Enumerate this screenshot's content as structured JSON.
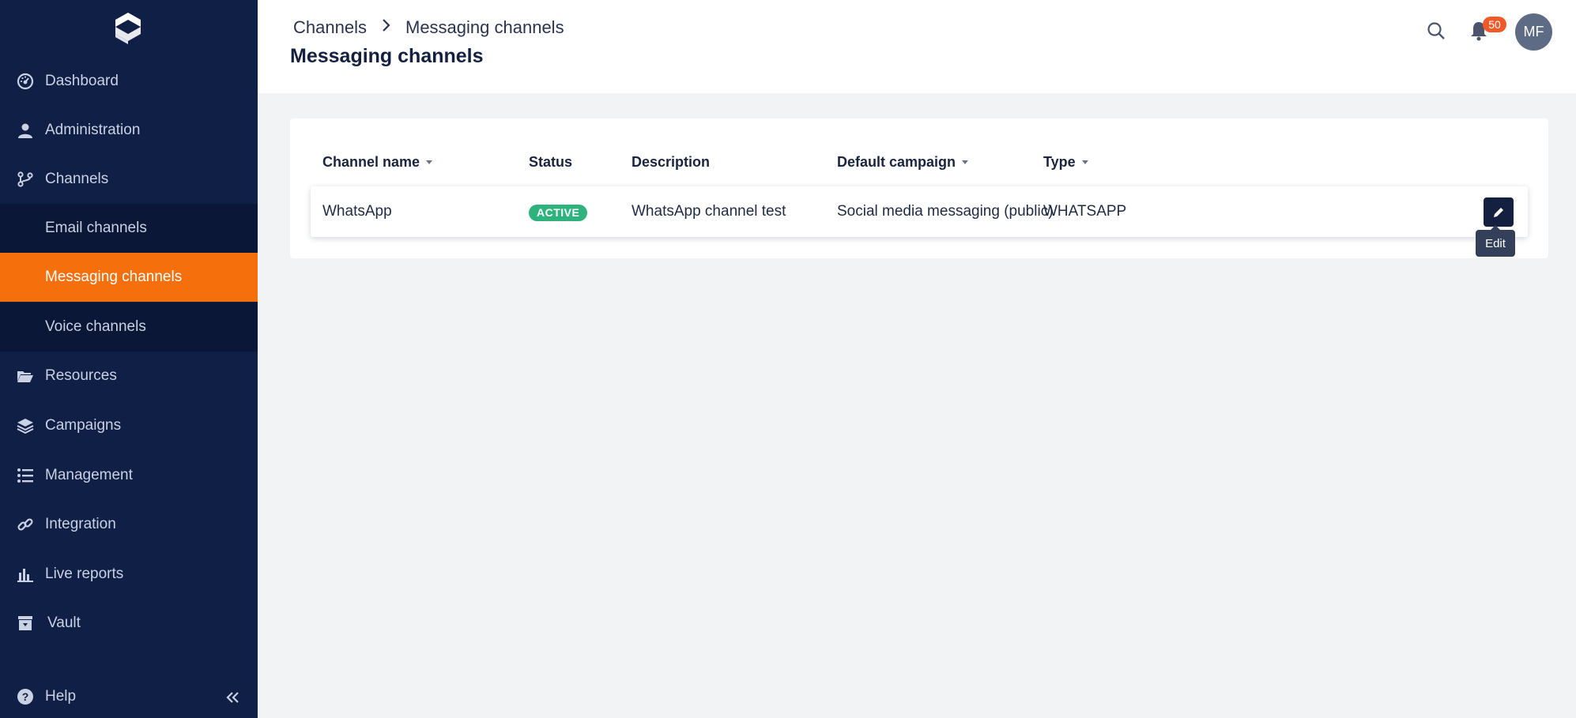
{
  "sidebar": {
    "items": [
      {
        "label": "Dashboard",
        "icon": "dashboard-gauge-icon"
      },
      {
        "label": "Administration",
        "icon": "user-icon"
      },
      {
        "label": "Channels",
        "icon": "branch-icon"
      },
      {
        "label": "Email channels"
      },
      {
        "label": "Messaging channels"
      },
      {
        "label": "Voice channels"
      },
      {
        "label": "Resources",
        "icon": "folder-open-icon"
      },
      {
        "label": "Campaigns",
        "icon": "layers-icon"
      },
      {
        "label": "Management",
        "icon": "list-icon"
      },
      {
        "label": "Integration",
        "icon": "link-icon"
      },
      {
        "label": "Live reports",
        "icon": "bar-chart-icon"
      },
      {
        "label": "Vault",
        "icon": "vault-box-icon"
      },
      {
        "label": "Help",
        "icon": "help-circle-icon"
      }
    ],
    "active": "Messaging channels"
  },
  "header": {
    "breadcrumb": [
      "Channels",
      "Messaging channels"
    ],
    "title": "Messaging channels",
    "notifications_count": "50",
    "avatar_initials": "MF"
  },
  "table": {
    "columns": [
      "Channel name",
      "Status",
      "Description",
      "Default campaign",
      "Type"
    ],
    "rows": [
      {
        "channel_name": "WhatsApp",
        "status": "ACTIVE",
        "description": "WhatsApp channel test",
        "default_campaign": "Social media messaging (public)",
        "type": "WHATSAPP"
      }
    ],
    "edit_tooltip": "Edit"
  },
  "colors": {
    "sidebar_bg": "#0f1f45",
    "active_item": "#f5700d",
    "status_active": "#2eb37d",
    "badge": "#f05a28"
  }
}
